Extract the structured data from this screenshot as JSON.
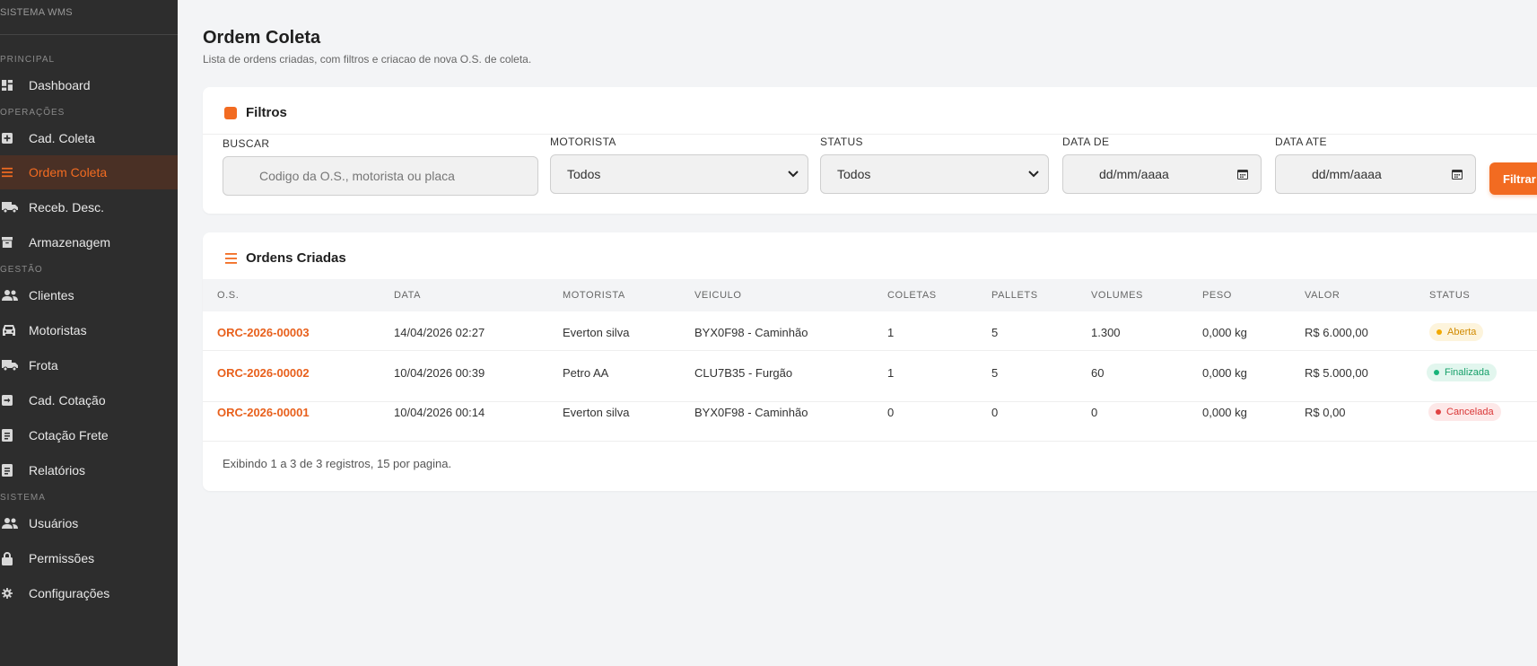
{
  "sidebar": {
    "brand": "SISTEMA WMS",
    "sections": {
      "principal": "PRINCIPAL",
      "operacoes": "OPERAÇÕES",
      "gestao": "GESTÃO",
      "sistema": "SISTEMA"
    },
    "items": [
      {
        "label": "Dashboard",
        "icon": "dashboard-icon"
      },
      {
        "label": "Cad. Coleta",
        "icon": "plus-square-icon"
      },
      {
        "label": "Ordem Coleta",
        "icon": "list-icon",
        "active": true
      },
      {
        "label": "Receb. Desc.",
        "icon": "truck-icon"
      },
      {
        "label": "Armazenagem",
        "icon": "archive-icon"
      },
      {
        "label": "Clientes",
        "icon": "users-icon"
      },
      {
        "label": "Motoristas",
        "icon": "car-icon"
      },
      {
        "label": "Frota",
        "icon": "truck-icon"
      },
      {
        "label": "Cad. Cotação",
        "icon": "login-icon"
      },
      {
        "label": "Cotação Frete",
        "icon": "document-icon"
      },
      {
        "label": "Relatórios",
        "icon": "document-icon"
      },
      {
        "label": "Usuários",
        "icon": "users-icon"
      },
      {
        "label": "Permissões",
        "icon": "lock-icon"
      },
      {
        "label": "Configurações",
        "icon": "gear-icon"
      }
    ]
  },
  "page": {
    "title": "Ordem Coleta",
    "subtitle": "Lista de ordens criadas, com filtros e criacao de nova O.S. de coleta."
  },
  "filters": {
    "title": "Filtros",
    "buscar_label": "BUSCAR",
    "buscar_placeholder": "Codigo da O.S., motorista ou placa",
    "motorista_label": "MOTORISTA",
    "motorista_value": "Todos",
    "status_label": "STATUS",
    "status_value": "Todos",
    "data_de_label": "DATA DE",
    "data_de_value": "dd/mm/aaaa",
    "data_ate_label": "DATA ATE",
    "data_ate_value": "dd/mm/aaaa",
    "button": "Filtrar"
  },
  "orders": {
    "title": "Ordens Criadas",
    "columns": [
      "O.S.",
      "DATA",
      "MOTORISTA",
      "VEICULO",
      "COLETAS",
      "PALLETS",
      "VOLUMES",
      "PESO",
      "VALOR",
      "STATUS"
    ],
    "rows": [
      {
        "os": "ORC-2026-00003",
        "data": "14/04/2026 02:27",
        "motorista": "Everton silva",
        "veiculo": "BYX0F98 - Caminhão",
        "coletas": "1",
        "pallets": "5",
        "volumes": "1.300",
        "peso": "0,000 kg",
        "valor": "R$ 6.000,00",
        "status": "Aberta"
      },
      {
        "os": "ORC-2026-00002",
        "data": "10/04/2026 00:39",
        "motorista": "Petro AA",
        "veiculo": "CLU7B35 - Furgão",
        "coletas": "1",
        "pallets": "5",
        "volumes": "60",
        "peso": "0,000 kg",
        "valor": "R$ 5.000,00",
        "status": "Finalizada"
      },
      {
        "os": "ORC-2026-00001",
        "data": "10/04/2026 00:14",
        "motorista": "Everton silva",
        "veiculo": "BYX0F98 - Caminhão",
        "coletas": "0",
        "pallets": "0",
        "volumes": "0",
        "peso": "0,000 kg",
        "valor": "R$ 0,00",
        "status": "Cancelada"
      }
    ],
    "footer": "Exibindo 1 a 3 de 3 registros, 15 por pagina."
  },
  "colors": {
    "accent": "#f26b21",
    "sidebar_bg": "#2d2d2d",
    "status_aberta": "#f2a900",
    "status_finalizada": "#19b37a",
    "status_cancelada": "#e04444"
  }
}
